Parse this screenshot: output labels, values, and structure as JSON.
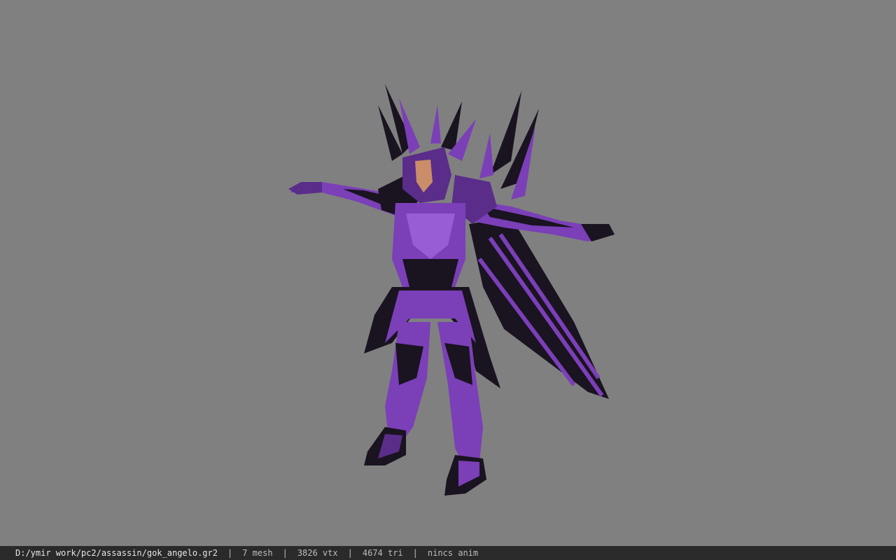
{
  "viewport": {
    "background_color": "#808080",
    "model": {
      "icon": "armored-character-model",
      "primary_color": "#7b3fb8",
      "dark_color": "#1a1320",
      "highlight_color": "#a56be0",
      "skin_color": "#c98d6a"
    }
  },
  "statusbar": {
    "file_path": "D:/ymir work/pc2/assassin/gok_angelo.gr2",
    "separator": "|",
    "mesh": "7 mesh",
    "vertices": "3826 vtx",
    "triangles": "4674 tri",
    "anim": "nincs anim"
  }
}
